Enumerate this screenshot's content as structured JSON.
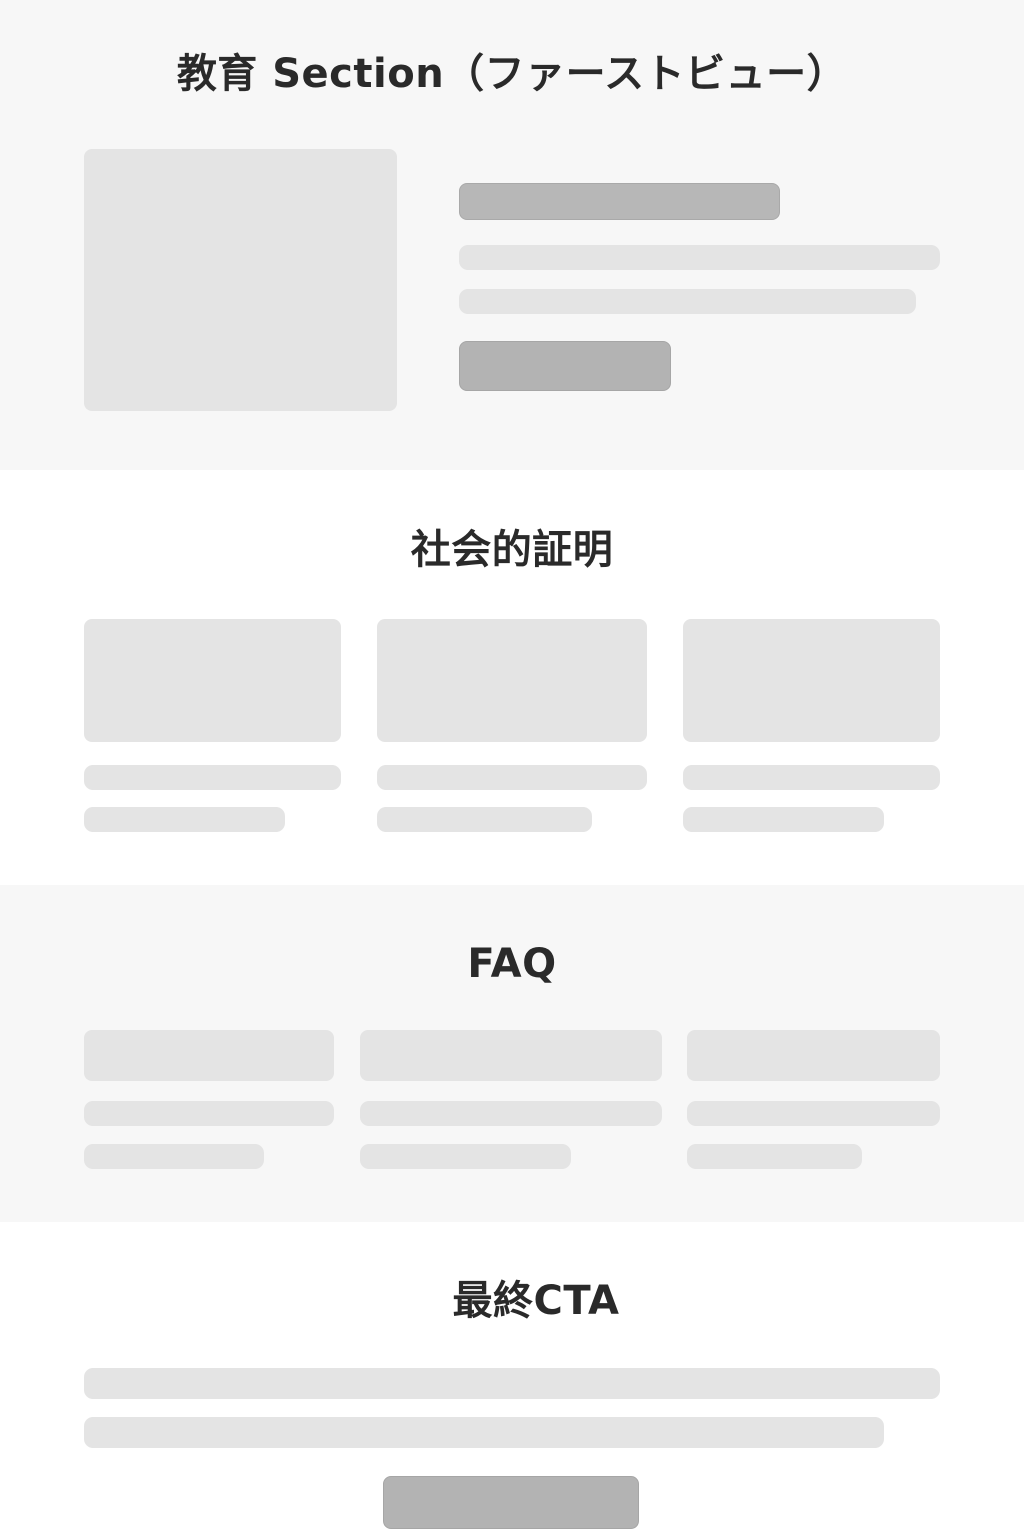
{
  "hero": {
    "title": "教育 Section（ファーストビュー）"
  },
  "social_proof": {
    "title": "社会的証明"
  },
  "faq": {
    "title": "FAQ"
  },
  "final_cta": {
    "title": "最終CTA"
  }
}
